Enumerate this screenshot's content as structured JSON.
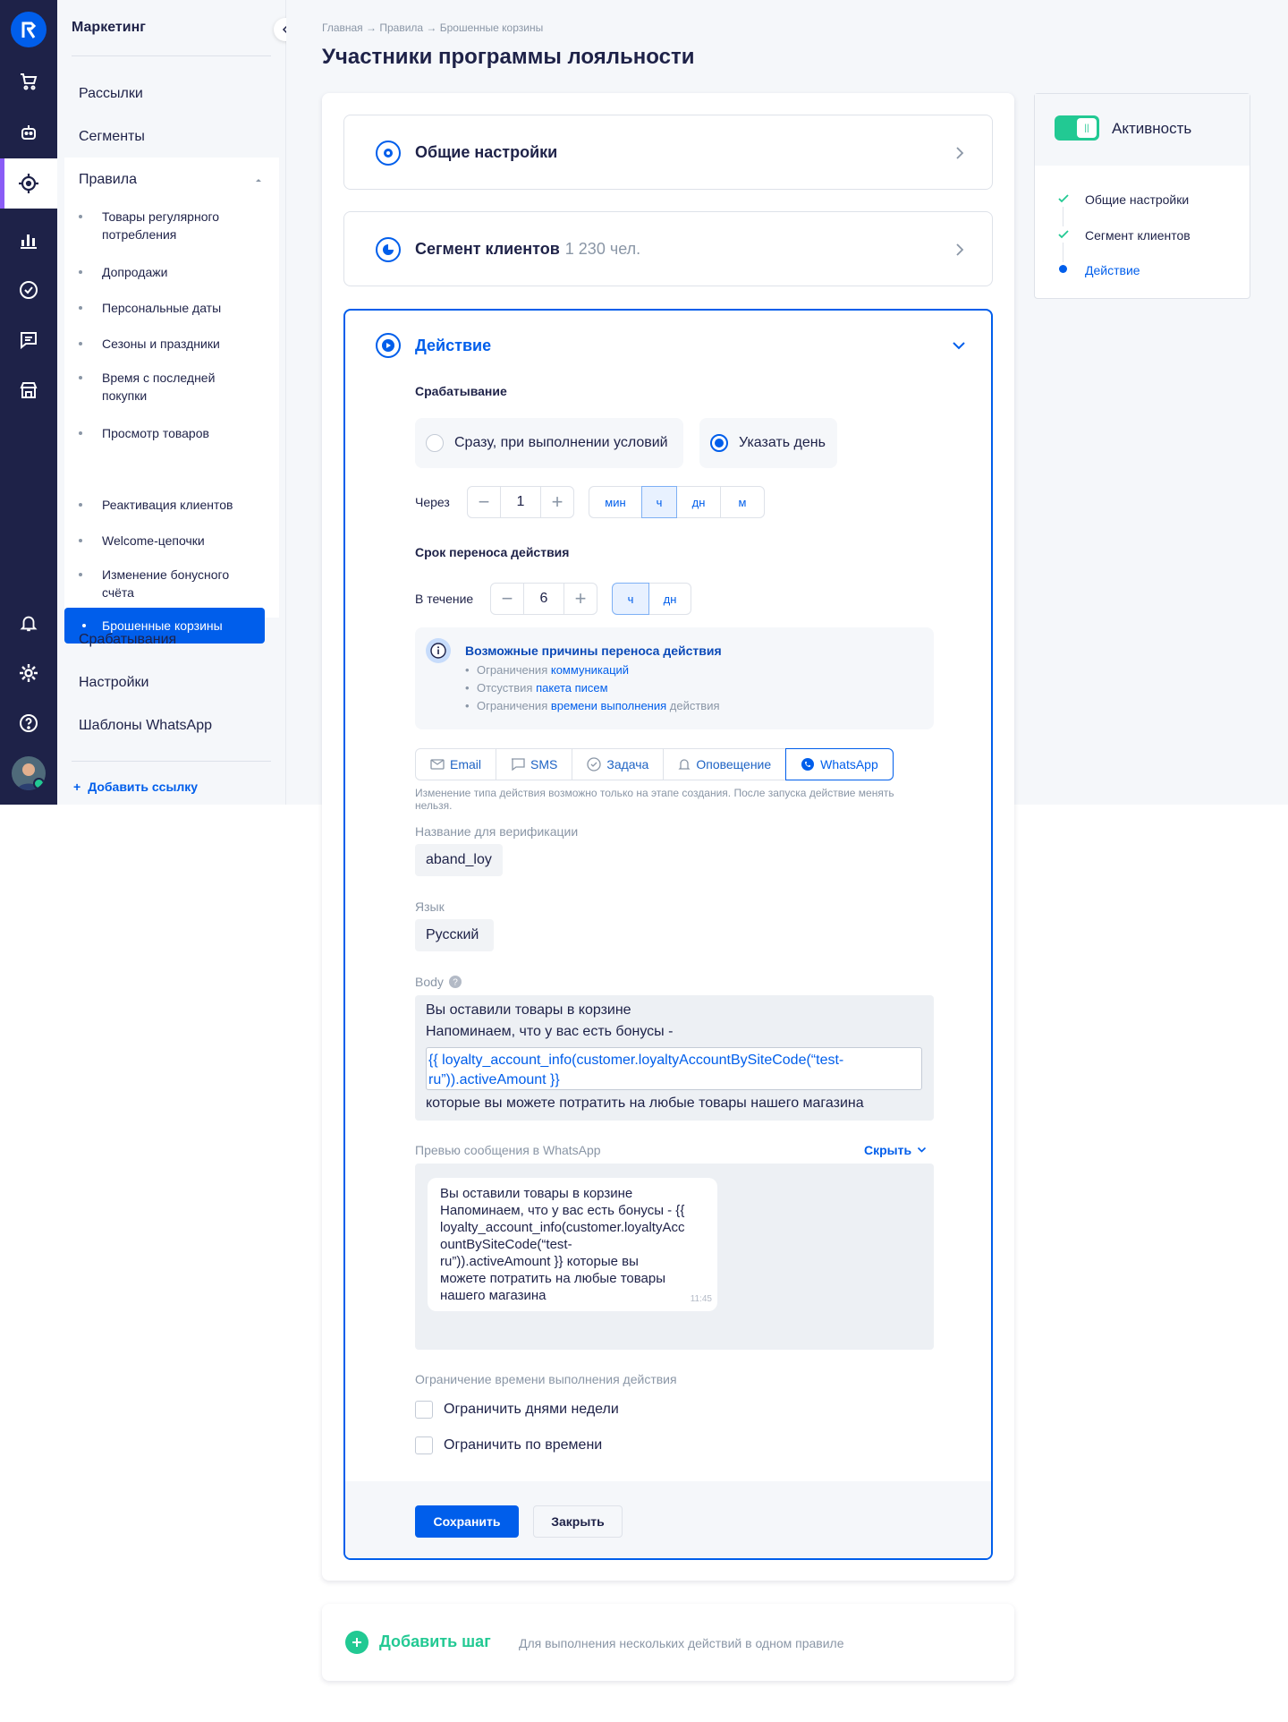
{
  "sidebar_title": "Маркетинг",
  "nav": {
    "items": [
      "Рассылки",
      "Сегменты",
      "Правила"
    ],
    "bottom": [
      "Срабатывания",
      "Настройки",
      "Шаблоны WhatsApp"
    ],
    "add_link": "Добавить ссылку"
  },
  "rules_sub": [
    "Товары регулярного потребления",
    "Допродажи",
    "Персональные даты",
    "Сезоны и праздники",
    "Время с последней покупки",
    "Просмотр товаров",
    "Брошенные корзины",
    "Реактивация клиентов",
    "Welcome-цепочки",
    "Изменение бонусного счёта"
  ],
  "breadcrumb": "Главная → Правила → Брошенные корзины",
  "page_title": "Участники программы лояльности",
  "general": {
    "title": "Общие настройки"
  },
  "segment": {
    "title": "Сегмент клиентов",
    "count": "1 230 чел."
  },
  "action": {
    "title": "Действие"
  },
  "trigger": {
    "label": "Срабатывание",
    "opt1": "Сразу, при выполнении условий",
    "opt2": "Указать день",
    "selected": "Указать день"
  },
  "after": {
    "label": "Через",
    "value": "1",
    "units": [
      "мин",
      "ч",
      "дн",
      "м"
    ],
    "selected_unit": "ч"
  },
  "transfer": {
    "label": "Срок переноса действия",
    "within": "В течение",
    "value": "6",
    "units": [
      "ч",
      "дн"
    ],
    "selected_unit": "ч"
  },
  "info": {
    "title": "Возможные причины переноса действия",
    "items": [
      {
        "pre": "Ограничения ",
        "link": "коммуникаций",
        "post": ""
      },
      {
        "pre": "Отсуствия ",
        "link": "пакета писем",
        "post": ""
      },
      {
        "pre": "Ограничения ",
        "link": "времени выполнения",
        "post": " действия"
      }
    ]
  },
  "channels": [
    "Email",
    "SMS",
    "Задача",
    "Оповещение",
    "WhatsApp"
  ],
  "selected_channel": "WhatsApp",
  "channel_note": "Изменение типа действия возможно только на этапе создания. После запуска действие менять нельзя.",
  "verify": {
    "label": "Название для верификации",
    "value": "aband_loy"
  },
  "lang": {
    "label": "Язык",
    "value": "Русский"
  },
  "body": {
    "label": "Body",
    "line1": "Вы оставили товары в корзине",
    "line2": "Напоминаем, что у вас есть бонусы -",
    "tpl1": "{{ loyalty_account_info(customer.loyaltyAccountBySiteCode(“test-",
    "tpl2": "ru”)).activeAmount  }}",
    "line3": "которые вы можете потратить на любые товары нашего магазина"
  },
  "preview": {
    "label": "Превью сообщения в WhatsApp",
    "hide": "Скрыть",
    "lines": [
      "Вы оставили товары в корзине",
      "Напоминаем, что у вас есть бонусы - {{",
      "loyalty_account_info(customer.loyaltyAcc",
      "ountBySiteCode(“test-",
      "ru”)).activeAmount  }} которые вы",
      "можете потратить на любые товары",
      "нашего магазина"
    ],
    "time": "11:45"
  },
  "limit": {
    "label": "Ограничение времени выполнения действия",
    "opt1": "Ограничить днями недели",
    "opt2": "Ограничить по времени"
  },
  "buttons": {
    "save": "Сохранить",
    "close": "Закрыть"
  },
  "add_step": {
    "title": "Добавить шаг",
    "hint": "Для выполнения нескольких действий в одном правиле"
  },
  "activity": {
    "label": "Активность",
    "on": true,
    "steps": [
      "Общие настройки",
      "Сегмент клиентов",
      "Действие"
    ]
  },
  "colors": {
    "primary": "#005eeb",
    "dark": "#1e2248",
    "green": "#22c993",
    "accent": "#8a5cf6"
  },
  "icons": [
    "logo-icon",
    "cart-icon",
    "bot-icon",
    "target-icon",
    "chart-icon",
    "check-circle-icon",
    "chat-icon",
    "store-icon",
    "bell-icon",
    "gear-icon",
    "help-icon"
  ]
}
